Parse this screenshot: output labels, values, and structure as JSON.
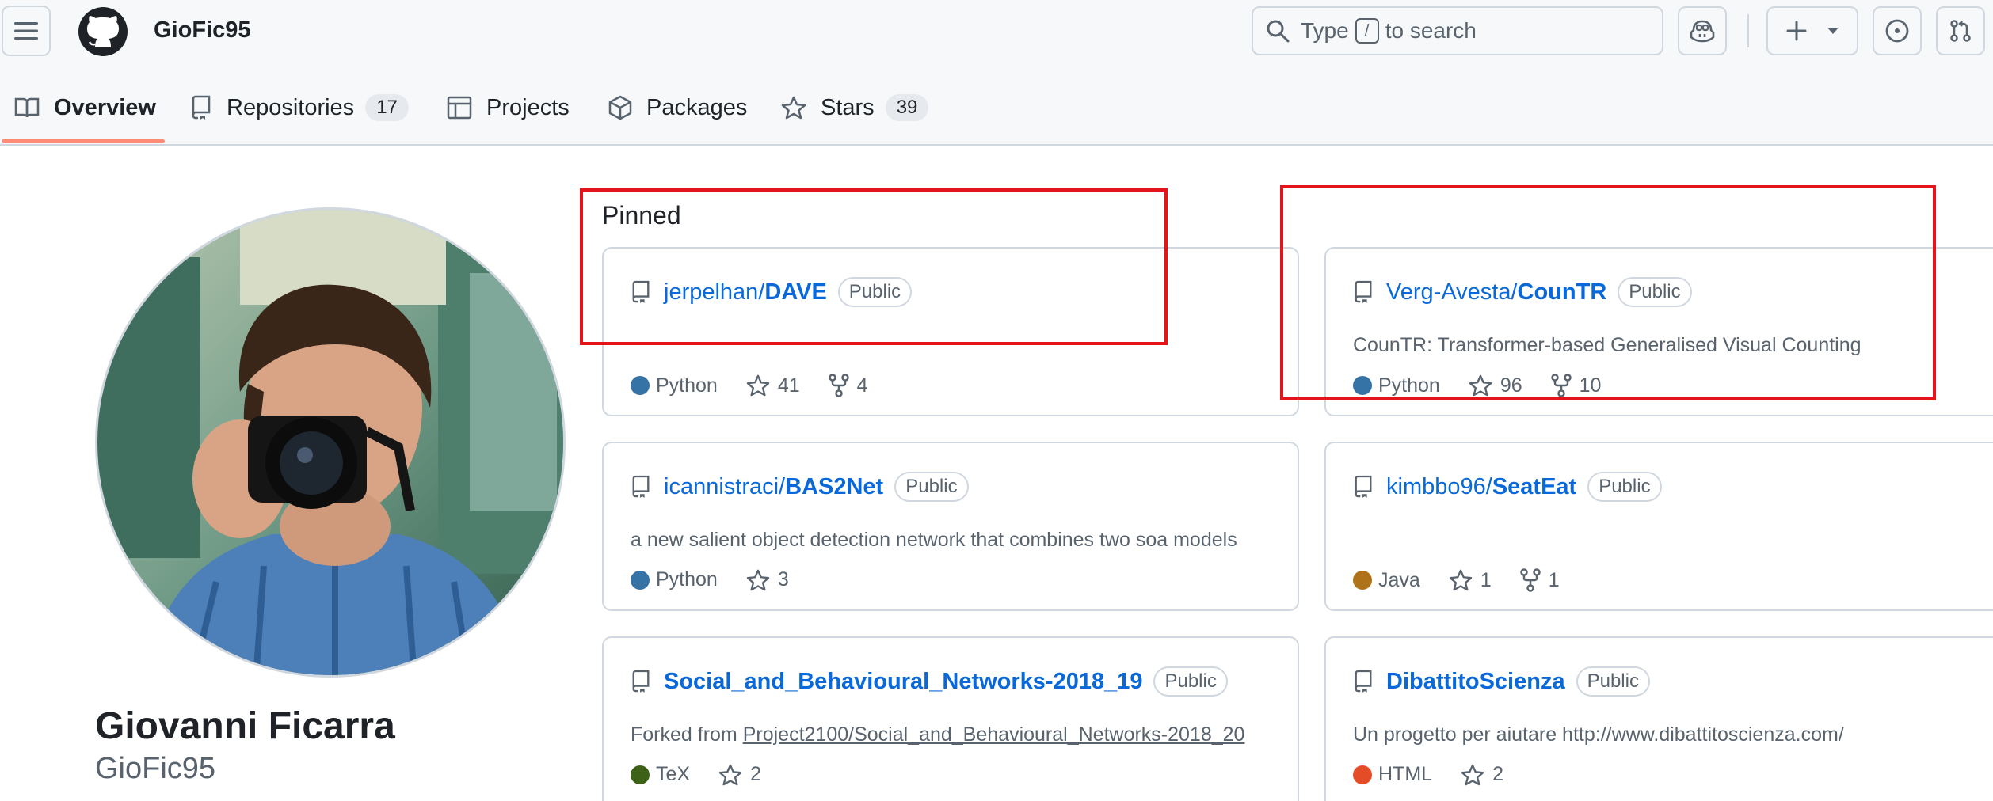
{
  "header": {
    "owner": "GioFic95",
    "search_prefix": "Type",
    "search_key": "/",
    "search_suffix": "to search"
  },
  "tabs": [
    {
      "label": "Overview"
    },
    {
      "label": "Repositories",
      "count": "17"
    },
    {
      "label": "Projects"
    },
    {
      "label": "Packages"
    },
    {
      "label": "Stars",
      "count": "39"
    }
  ],
  "profile": {
    "full_name": "Giovanni Ficarra",
    "login": "GioFic95"
  },
  "pinned": {
    "title": "Pinned",
    "repos": [
      {
        "owner": "jerpelhan/",
        "name": "DAVE",
        "visibility": "Public",
        "description": "",
        "language": "Python",
        "lang_color": "#3572A5",
        "stars": "41",
        "forks": "4"
      },
      {
        "owner": "Verg-Avesta/",
        "name": "CounTR",
        "visibility": "Public",
        "description": "CounTR: Transformer-based Generalised Visual Counting",
        "language": "Python",
        "lang_color": "#3572A5",
        "stars": "96",
        "forks": "10"
      },
      {
        "owner": "icannistraci/",
        "name": "BAS2Net",
        "visibility": "Public",
        "description": "a new salient object detection network that combines two soa models",
        "language": "Python",
        "lang_color": "#3572A5",
        "stars": "3"
      },
      {
        "owner": "kimbbo96/",
        "name": "SeatEat",
        "visibility": "Public",
        "description": "",
        "language": "Java",
        "lang_color": "#b07219",
        "stars": "1",
        "forks": "1"
      },
      {
        "owner": "",
        "name": "Social_and_Behavioural_Networks-2018_19",
        "visibility": "Public",
        "description_prefix": "Forked from ",
        "fork_source": "Project2100/Social_and_Behavioural_Networks-2018_20",
        "language": "TeX",
        "lang_color": "#3D6117",
        "stars": "2"
      },
      {
        "owner": "",
        "name": "DibattitoScienza",
        "visibility": "Public",
        "description": "Un progetto per aiutare http://www.dibattitoscienza.com/",
        "language": "HTML",
        "lang_color": "#e34c26",
        "stars": "2"
      }
    ]
  },
  "colors": {
    "link": "#0969da",
    "muted": "#59636e",
    "border": "#d0d7de",
    "tab_underline": "#fd8c73",
    "annotation_box": "#e5141b"
  }
}
